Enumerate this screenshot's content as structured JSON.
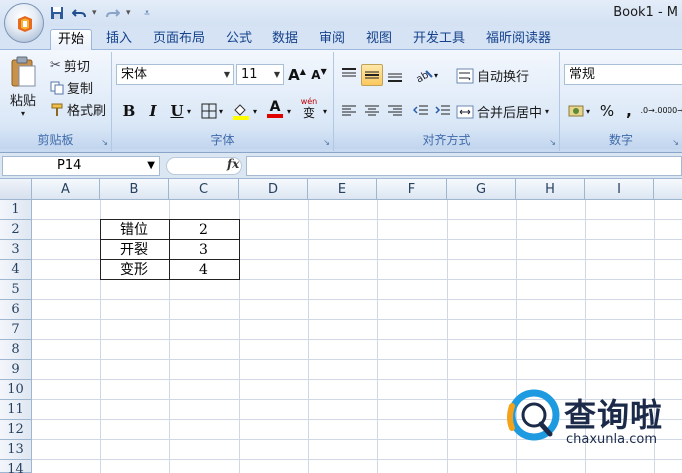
{
  "window": {
    "title": "Book1 - M"
  },
  "quick_access": [
    {
      "name": "save-icon",
      "glyph": "💾"
    },
    {
      "name": "undo-icon",
      "glyph": "↶"
    },
    {
      "name": "redo-icon",
      "glyph": "↷"
    },
    {
      "name": "customize-icon",
      "glyph": "▾"
    }
  ],
  "tabs": [
    "开始",
    "插入",
    "页面布局",
    "公式",
    "数据",
    "审阅",
    "视图",
    "开发工具",
    "福昕阅读器"
  ],
  "ribbon": {
    "clipboard": {
      "paste": "粘贴",
      "cut": "剪切",
      "copy": "复制",
      "format_painter": "格式刷",
      "label": "剪贴板"
    },
    "font": {
      "name": "宋体",
      "size": "11",
      "grow": "A",
      "shrink": "A",
      "bold": "B",
      "italic": "I",
      "underline": "U",
      "font_color": "A",
      "phonetic": "wén",
      "phonetic_char": "变",
      "label": "字体"
    },
    "alignment": {
      "wrap": "自动换行",
      "merge": "合并后居中",
      "label": "对齐方式"
    },
    "number": {
      "format": "常规",
      "percent": "%",
      "comma": ",",
      "inc_decimal": ".0→.00",
      "dec_decimal": ".00→.0",
      "label": "数字"
    }
  },
  "formula_bar": {
    "name_box": "P14",
    "fx": "fx",
    "value": ""
  },
  "sheet": {
    "columns": [
      "A",
      "B",
      "C",
      "D",
      "E",
      "F",
      "G",
      "H",
      "I"
    ],
    "rows": [
      "1",
      "2",
      "3",
      "4",
      "5",
      "6",
      "7",
      "8",
      "9",
      "10",
      "11",
      "12",
      "13",
      "14"
    ],
    "cells": [
      {
        "ref": "B2",
        "value": "错位"
      },
      {
        "ref": "C2",
        "value": "2"
      },
      {
        "ref": "B3",
        "value": "开裂"
      },
      {
        "ref": "C3",
        "value": "3"
      },
      {
        "ref": "B4",
        "value": "变形"
      },
      {
        "ref": "C4",
        "value": "4"
      }
    ]
  },
  "watermark": {
    "brand": "查询啦",
    "domain": "chaxunla.com"
  },
  "colors": {
    "accent": "#15428b",
    "ribbon": "#dbe8f7",
    "grid_line": "#d0d7e5",
    "watermark_blue": "#1e9ae0"
  }
}
